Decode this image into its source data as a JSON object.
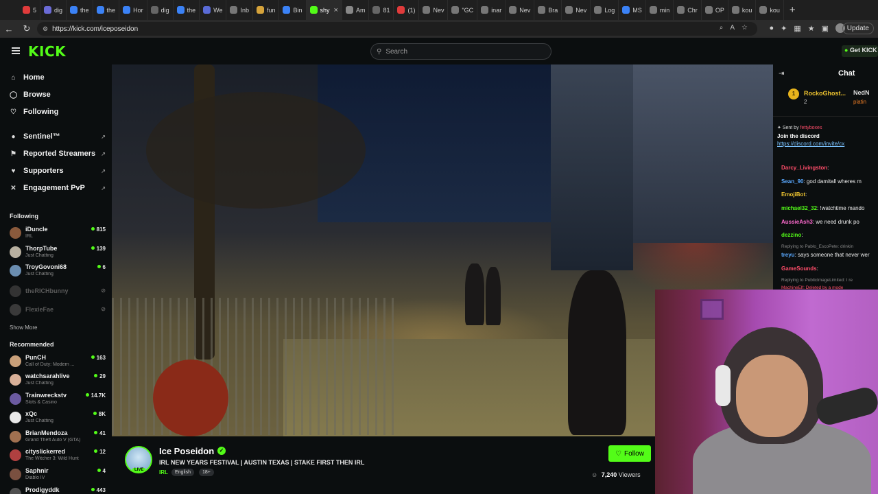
{
  "browser": {
    "tabs": [
      {
        "label": "5",
        "active": false
      },
      {
        "label": "dig",
        "active": false
      },
      {
        "label": "the",
        "active": false
      },
      {
        "label": "the",
        "active": false
      },
      {
        "label": "Hor",
        "active": false
      },
      {
        "label": "dig",
        "active": false
      },
      {
        "label": "the",
        "active": false
      },
      {
        "label": "We",
        "active": false
      },
      {
        "label": "Inb",
        "active": false
      },
      {
        "label": "fun",
        "active": false
      },
      {
        "label": "Bin",
        "active": false
      },
      {
        "label": "shy",
        "active": true
      },
      {
        "label": "Am",
        "active": false
      },
      {
        "label": "81",
        "active": false
      },
      {
        "label": "(1)",
        "active": false
      },
      {
        "label": "Nev",
        "active": false
      },
      {
        "label": "\"GC",
        "active": false
      },
      {
        "label": "inar",
        "active": false
      },
      {
        "label": "Nev",
        "active": false
      },
      {
        "label": "Bra",
        "active": false
      },
      {
        "label": "Nev",
        "active": false
      },
      {
        "label": "Log",
        "active": false
      },
      {
        "label": "MS",
        "active": false
      },
      {
        "label": "min",
        "active": false
      },
      {
        "label": "Chr",
        "active": false
      },
      {
        "label": "OP",
        "active": false
      },
      {
        "label": "kou",
        "active": false
      },
      {
        "label": "kou",
        "active": false
      }
    ],
    "url": "https://kick.com/iceposeidon",
    "update_label": "Update"
  },
  "header": {
    "logo": "KICK",
    "search_placeholder": "Search",
    "get_kick": "Get KICK"
  },
  "sidebar": {
    "nav": [
      {
        "label": "Home",
        "icon": "home-icon"
      },
      {
        "label": "Browse",
        "icon": "compass-icon"
      },
      {
        "label": "Following",
        "icon": "heart-icon"
      }
    ],
    "extensions": [
      {
        "label": "Sentinel™"
      },
      {
        "label": "Reported Streamers"
      },
      {
        "label": "Supporters"
      },
      {
        "label": "Engagement PvP"
      }
    ],
    "following_title": "Following",
    "following": [
      {
        "name": "iDuncle",
        "category": "IRL",
        "viewers": "815",
        "live": true
      },
      {
        "name": "ThorpTube",
        "category": "Just Chatting",
        "viewers": "139",
        "live": true
      },
      {
        "name": "TroyGovoni68",
        "category": "Just Chatting",
        "viewers": "6",
        "live": true
      },
      {
        "name": "theRICHbunny",
        "category": "",
        "viewers": "",
        "live": false
      },
      {
        "name": "FlexieFae",
        "category": "",
        "viewers": "",
        "live": false
      }
    ],
    "show_more": "Show More",
    "recommended_title": "Recommended",
    "recommended": [
      {
        "name": "PunCH",
        "category": "Call of Duty: Modern ...",
        "viewers": "163"
      },
      {
        "name": "watchsarahlive",
        "category": "Just Chatting",
        "viewers": "29"
      },
      {
        "name": "Trainwreckstv",
        "category": "Slots & Casino",
        "viewers": "14.7K"
      },
      {
        "name": "xQc",
        "category": "Just Chatting",
        "viewers": "8K"
      },
      {
        "name": "BrianMendoza",
        "category": "Grand Theft Auto V (GTA)",
        "viewers": "41"
      },
      {
        "name": "cityslickerred",
        "category": "The Witcher 3: Wild Hunt",
        "viewers": "12"
      },
      {
        "name": "Saphnir",
        "category": "Diablo IV",
        "viewers": "4"
      },
      {
        "name": "Prodigyddk",
        "category": "",
        "viewers": "443"
      }
    ]
  },
  "stream": {
    "streamer": "Ice Poseidon",
    "live_badge": "LIVE",
    "title": "IRL NEW YEARS FESTIVAL | AUSTIN TEXAS | STAKE FIRST THEN IRL",
    "category": "IRL",
    "tags": [
      "English",
      "18+"
    ],
    "follow_label": "Follow",
    "viewers_count": "7,240",
    "viewers_label": "Viewers"
  },
  "chat": {
    "title": "Chat",
    "leader1": {
      "rank": "1",
      "name": "RockoGhost...",
      "sub": "2"
    },
    "leader2": {
      "name": "NedN",
      "sub": "platin"
    },
    "pinned_by_label": "Sent by",
    "pinned_by_name": "fettyboxes",
    "pinned_message": "Join the discord",
    "pinned_link": "https://discord.com/invite/cx",
    "messages": [
      {
        "user": "Darcy_Livingston",
        "text": ":",
        "color": "#ff4d6a"
      },
      {
        "user": "Sean_90",
        "text": ": god damitall wheres m",
        "color": "#5aa9ff"
      },
      {
        "user": "EmojiBot",
        "text": ":",
        "color": "#f0c530"
      },
      {
        "user": "michael32_32",
        "text": ": !watchtime mando",
        "color": "#53fc18"
      },
      {
        "user": "AussieAsh3",
        "text": ": we need drunk po",
        "color": "#ff6bd0"
      },
      {
        "user": "dezzino",
        "text": ":",
        "color": "#53fc18"
      },
      {
        "user": "treyu",
        "text": ": says someone that never wer",
        "color": "#5aa9ff"
      },
      {
        "user": "GameSounds",
        "text": ":",
        "color": "#ff4d6a"
      }
    ],
    "replies": [
      "Replying to Pablo_EscoPete: drinkin",
      "Replying to PublicImageLimited: I re"
    ],
    "last_line": "MachineElf: Deleted by a mode"
  },
  "colors": {
    "brand": "#53fc18",
    "background": "#0b0e0f"
  }
}
